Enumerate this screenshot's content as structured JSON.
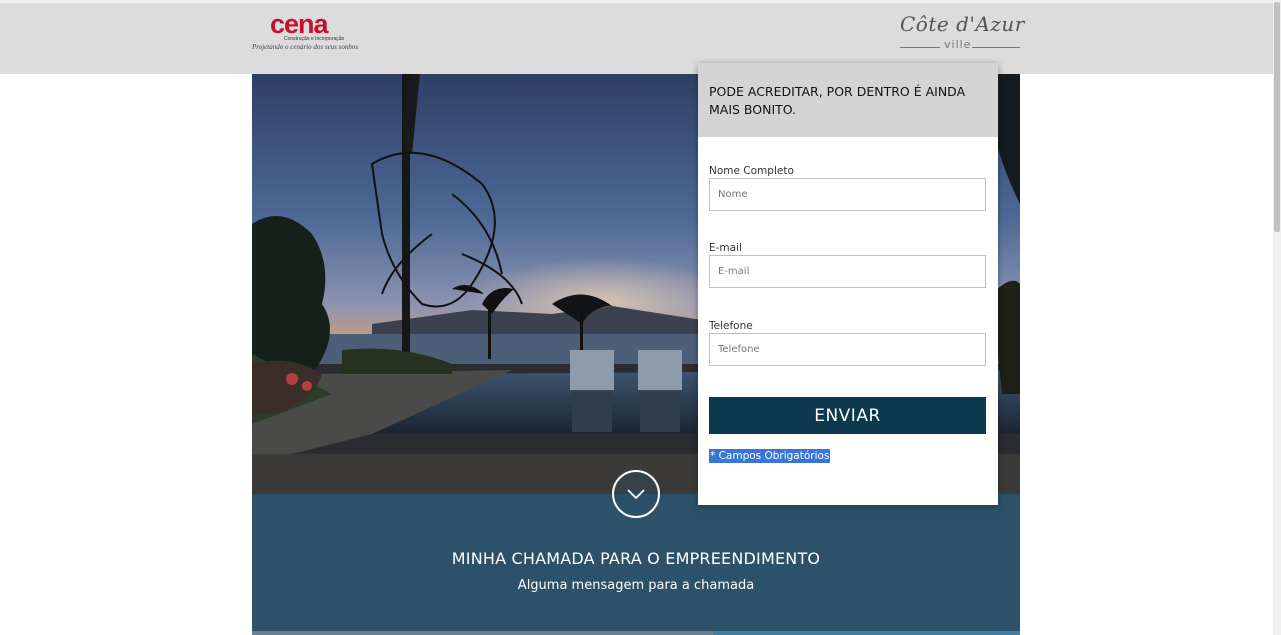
{
  "header": {
    "logo_left": {
      "wordmark": "cena",
      "subtitle": "Construção e Incorporação",
      "tagline": "Projetando o cenário dos seus sonhos"
    },
    "logo_right": {
      "script": "Côte d'Azur",
      "sub": "ville"
    }
  },
  "form": {
    "heading": "PODE ACREDITAR, POR DENTRO É AINDA MAIS BONITO.",
    "fields": [
      {
        "label": "Nome Completo",
        "placeholder": "Nome",
        "value": ""
      },
      {
        "label": "E-mail",
        "placeholder": "E-mail",
        "value": ""
      },
      {
        "label": "Telefone",
        "placeholder": "Telefone",
        "value": ""
      }
    ],
    "submit_label": "ENVIAR",
    "required_note": "* Campos Obrigatórios"
  },
  "band": {
    "title": "MINHA CHAMADA PARA O EMPREENDIMENTO",
    "subtitle": "Alguma mensagem para a chamada"
  },
  "icons": {
    "scroll_down": "chevron-down-icon"
  },
  "colors": {
    "header_bg": "#dcdcdc",
    "band_bg": "#2c5168",
    "button_bg": "#0d394f",
    "brand_red": "#c8102e",
    "selection": "#3875d7"
  }
}
